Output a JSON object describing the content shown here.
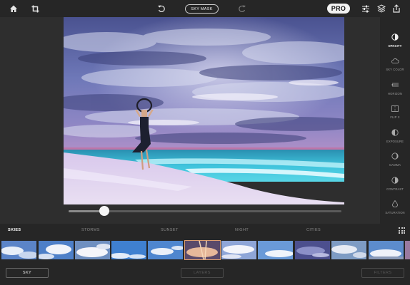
{
  "toolbar": {
    "home_icon": "home-icon",
    "crop_icon": "crop-icon",
    "undo_icon": "undo-icon",
    "redo_icon": "redo-icon",
    "sky_mask_label": "SKY MASK",
    "pro_label": "PRO",
    "adjust_icon": "sliders-icon",
    "layers_icon": "layers-icon",
    "share_icon": "share-icon"
  },
  "editor": {
    "slider_value": 0.13
  },
  "tools": [
    {
      "label": "OPACITY",
      "icon": "opacity-icon",
      "active": true
    },
    {
      "label": "SKY COLOR",
      "icon": "cloud-icon",
      "active": false
    },
    {
      "label": "HORIZON",
      "icon": "horizon-icon",
      "active": false
    },
    {
      "label": "FLIP X",
      "icon": "flip-icon",
      "active": false
    },
    {
      "label": "EXPOSURE",
      "icon": "exposure-icon",
      "active": false
    },
    {
      "label": "GAMMA",
      "icon": "gamma-icon",
      "active": false
    },
    {
      "label": "CONTRAST",
      "icon": "contrast-icon",
      "active": false
    },
    {
      "label": "SATURATION",
      "icon": "drop-icon",
      "active": false
    }
  ],
  "categories": {
    "skies": "SKIES",
    "storms": "STORMS",
    "sunset": "SUNSET",
    "night": "NIGHT",
    "cities": "CITIES"
  },
  "bottom": {
    "sky_label": "SKY",
    "layers_label": "LAYERS",
    "filters_label": "FILTERS"
  },
  "colors": {
    "background": "#262626",
    "accent": "#ffffff",
    "sea": "#3ec6de"
  }
}
